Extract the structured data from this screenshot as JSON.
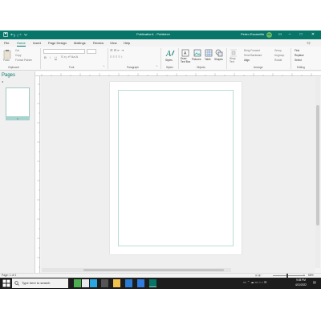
{
  "titlebar": {
    "title": "Publication1 - Publisher",
    "user": "Pedro Escamilla",
    "avatar_initials": "PE",
    "minimize": "–",
    "restore": "□",
    "close": "✕"
  },
  "menu": {
    "tabs": [
      "File",
      "Home",
      "Insert",
      "Page Design",
      "Mailings",
      "Review",
      "View",
      "Help"
    ],
    "share": "🗨"
  },
  "ribbon": {
    "clipboard": {
      "paste": "Paste",
      "cut": "Cut",
      "copy": "Copy",
      "format_painter": "Format Painter",
      "label": "Clipboard"
    },
    "font": {
      "label": "Font",
      "bold": "B",
      "italic": "I",
      "underline": "U"
    },
    "paragraph": {
      "label": "Paragraph"
    },
    "styles": {
      "label": "Styles",
      "button": "Styles"
    },
    "objects": {
      "label": "Objects",
      "draw_text_box": "Draw Text Box",
      "pictures": "Pictures",
      "table": "Table",
      "shapes": "Shapes"
    },
    "arrange": {
      "label": "Arrange",
      "wrap_text": "Wrap Text",
      "bring_forward": "Bring Forward",
      "send_backward": "Send Backward",
      "align": "Align",
      "group": "Group",
      "ungroup": "Ungroup",
      "rotate": "Rotate"
    },
    "editing": {
      "label": "Editing",
      "find": "Find",
      "replace": "Replace",
      "select": "Select"
    }
  },
  "pages_pane": {
    "title": "Pages",
    "thumbnail_number": "1"
  },
  "statusbar": {
    "page_indicator": "Page: 1 of 1",
    "zoom": "68%"
  },
  "taskbar": {
    "search_placeholder": "Type here to search",
    "time": "9:05 PM",
    "date": "4/11/2022"
  },
  "colors": {
    "accent": "#077568",
    "taskbar": "#1d1d1d"
  }
}
